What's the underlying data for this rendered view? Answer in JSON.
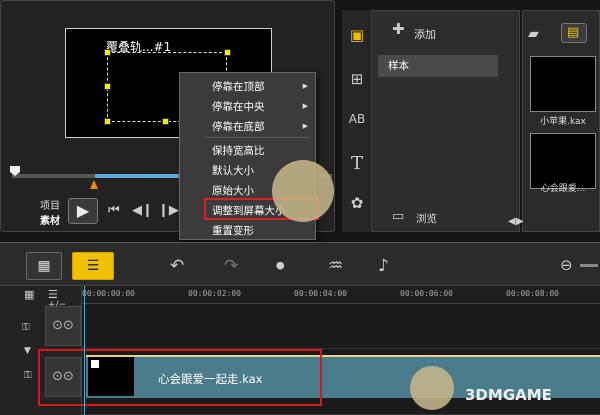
{
  "preview": {
    "overlay_title": "覆叠轨...#1",
    "mode_project": "项目",
    "mode_clip": "素材"
  },
  "context_menu": {
    "items": [
      {
        "label": "停靠在顶部",
        "submenu": true
      },
      {
        "label": "停靠在中央",
        "submenu": true
      },
      {
        "label": "停靠在底部",
        "submenu": true
      },
      {
        "label": "保持宽高比",
        "submenu": false
      },
      {
        "label": "默认大小",
        "submenu": false
      },
      {
        "label": "原始大小",
        "submenu": false
      },
      {
        "label": "调整到屏幕大小",
        "submenu": false
      },
      {
        "label": "重置变形",
        "submenu": false
      }
    ],
    "highlighted_index": 6
  },
  "library": {
    "add_label": "添加",
    "selected_item": "样本",
    "browse_label": "浏览"
  },
  "media": {
    "thumbs": [
      {
        "label": "小苹果.kax"
      },
      {
        "label": "心会跟爱..."
      }
    ]
  },
  "timeline": {
    "ruler_times": [
      "00:00:00:00",
      "00:00:02:00",
      "00:00:04:00",
      "00:00:06:00",
      "00:00:08:00"
    ],
    "clip_label": "心会跟爱一起走.kax"
  },
  "watermark": "3DMGAME",
  "colors": {
    "highlight_red": "#e02020",
    "accent_yellow": "#f0c000",
    "clip_teal": "#4a7b8a"
  }
}
